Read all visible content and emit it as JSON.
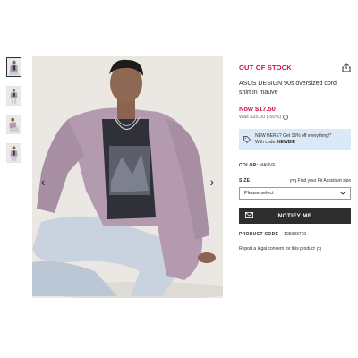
{
  "product": {
    "status": "OUT OF STOCK",
    "title": "ASOS DESIGN 90s oversized cord shirt in mauve",
    "price_now": "Now $17.50",
    "price_was": "Was $35.00 (-50%)"
  },
  "promo": {
    "line1": "NEW HERE? Get 15% off everything!*",
    "line2_prefix": "With code: ",
    "code": "NEWBIE"
  },
  "color": {
    "label": "COLOR:",
    "value": "MAUVE"
  },
  "size": {
    "label": "SIZE:",
    "fit_link": "Find your Fit Assistant size",
    "select_value": "Please select"
  },
  "notify_label": "NOTIFY ME",
  "product_code": {
    "label": "PRODUCT CODE",
    "value": "105083770"
  },
  "legal_link": "Report a legal concern for this product",
  "gallery": {
    "thumb_count": 4,
    "active_index": 0
  },
  "colors": {
    "accent_red": "#d01345",
    "promo_bg": "#dbe8f6",
    "button_dark": "#2d2d2d",
    "shirt_mauve": "#b39aae"
  },
  "icons": [
    "share-icon",
    "chevron-left-icon",
    "chevron-right-icon",
    "tag-icon",
    "ruler-icon",
    "chevron-down-icon",
    "mail-icon",
    "info-icon",
    "external-link-icon"
  ]
}
